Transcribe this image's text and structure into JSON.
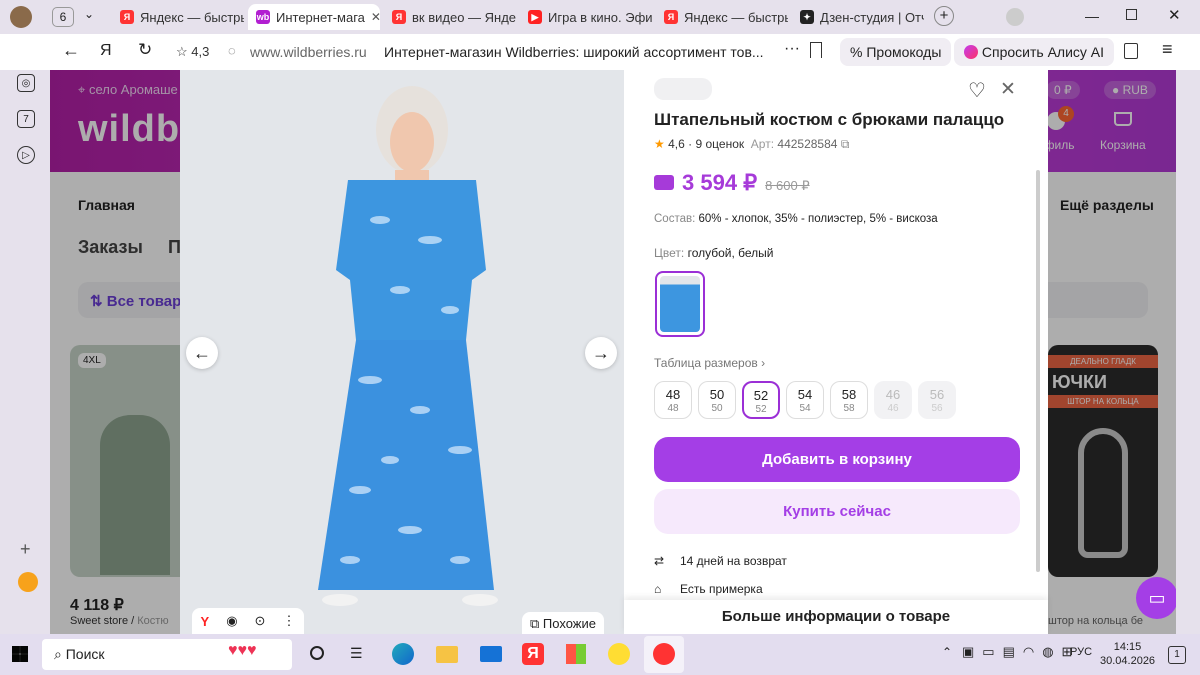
{
  "browser": {
    "tab_count": "6",
    "tabs": [
      {
        "label": "Яндекс — быстры",
        "fav": "Я",
        "color": "#f33"
      },
      {
        "label": "Интернет-мага",
        "fav": "wb",
        "color": "#b21fd1"
      },
      {
        "label": "вк видео — Яндек",
        "fav": "Я",
        "color": "#f33"
      },
      {
        "label": "Игра в кино. Эфир",
        "fav": "▶",
        "color": "#f22"
      },
      {
        "label": "Яндекс — быстры",
        "fav": "Я",
        "color": "#f33"
      },
      {
        "label": "Дзен-студия | Отч",
        "fav": "✦",
        "color": "#222"
      }
    ],
    "rating": "4,3",
    "url": "www.wildberries.ru",
    "page_title": "Интернет-магазин Wildberries: широкий ассортимент тов...",
    "promo_label": "Промокоды",
    "alice_label": "Спросить Алису AI"
  },
  "site": {
    "location": "село Аромаше",
    "logo": "wildbe",
    "balance": "0 ₽",
    "currency": "RUB",
    "cart_badge": "4",
    "profile_label": "офиль",
    "cart_label": "Корзина",
    "nav_main": "Главная",
    "nav_more": "Ещё разделы",
    "orders": "Заказы",
    "orders_next": "П",
    "sort_label": "Все товар",
    "card_size": "4XL",
    "card_price": "4 118 ₽",
    "card_seller": "Sweet store",
    "card_category": "Костю",
    "promo_card_tag": "ДЕАЛЬНО ГЛАДК",
    "promo_card_title": "ЮЧКИ",
    "promo_card_sub": "ШТОР НА КОЛЬЦА",
    "promo_card_caption": "штор на кольца бе"
  },
  "product": {
    "title": "Штапельный костюм с брюками палаццо",
    "rating": "4,6",
    "reviews": "· 9 оценок",
    "article_label": "Арт:",
    "article": "442528584",
    "price": "3 594 ₽",
    "old_price": "8 600 ₽",
    "composition_label": "Состав:",
    "composition": "60% - хлопок, 35% - полиэстер, 5% - вискоза",
    "color_label": "Цвет:",
    "color": "голубой, белый",
    "size_table": "Таблица размеров",
    "sizes": [
      {
        "size": "48",
        "ru": "48",
        "state": "normal"
      },
      {
        "size": "50",
        "ru": "50",
        "state": "normal"
      },
      {
        "size": "52",
        "ru": "52",
        "state": "selected"
      },
      {
        "size": "54",
        "ru": "54",
        "state": "normal"
      },
      {
        "size": "58",
        "ru": "58",
        "state": "normal"
      },
      {
        "size": "46",
        "ru": "46",
        "state": "disabled"
      },
      {
        "size": "56",
        "ru": "56",
        "state": "disabled"
      }
    ],
    "add_to_cart": "Добавить в корзину",
    "buy_now": "Купить сейчас",
    "return_info": "14 дней на возврат",
    "fitting": "Есть примерка",
    "more_info": "Больше информации о товаре",
    "similar": "Похожие"
  },
  "taskbar": {
    "search": "Поиск",
    "lang": "РУС",
    "time": "14:15",
    "date": "30.04.2026",
    "notif": "1"
  },
  "colors": {
    "accent": "#9b2fd6",
    "price": "#a63ad9",
    "wb_header": "#b320a7"
  }
}
